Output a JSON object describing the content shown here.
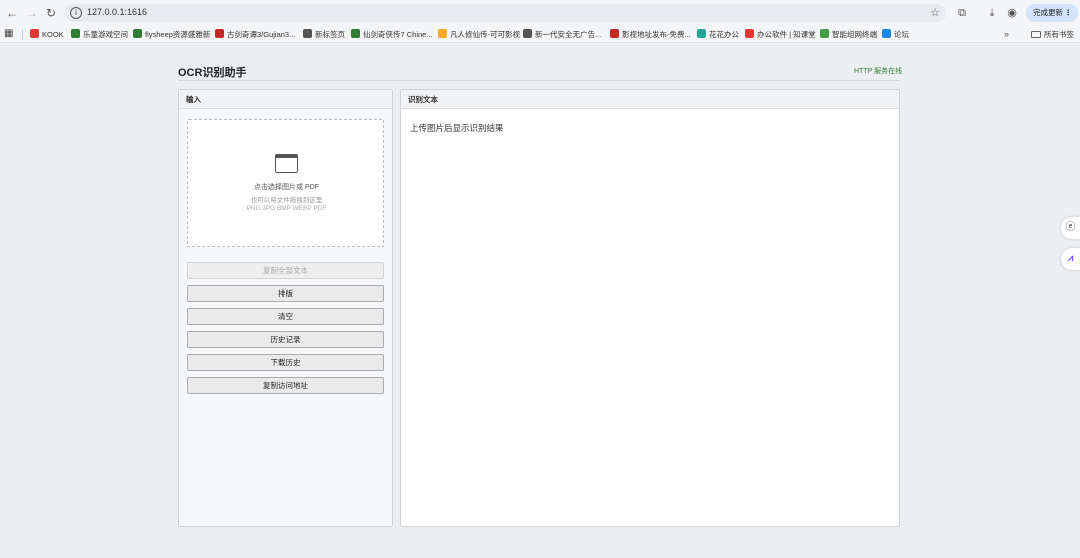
{
  "browser": {
    "url": "127.0.0.1:1616",
    "update_button": "完成更新",
    "bookmarks": [
      {
        "label": "KOOK",
        "color": "#e53935"
      },
      {
        "label": "乐童游戏空间",
        "color": "#2e7d32"
      },
      {
        "label": "flysheep资源盛雅新",
        "color": "#2e7d32"
      },
      {
        "label": "古剑奇谭3/Gujian3...",
        "color": "#c62828"
      },
      {
        "label": "新标签页",
        "color": "#555555"
      },
      {
        "label": "仙剑奇侠传7 Chine...",
        "color": "#2e7d32"
      },
      {
        "label": "凡人修仙传-可可影视",
        "color": "#f9a825"
      },
      {
        "label": "新一代安全无广告...",
        "color": "#555555"
      },
      {
        "label": "影视地址发布-免费...",
        "color": "#c62828"
      },
      {
        "label": "花花办公",
        "color": "#26a69a"
      },
      {
        "label": "办公软件 | 知课堂",
        "color": "#e53935"
      },
      {
        "label": "智能组网终端",
        "color": "#43a047"
      },
      {
        "label": "论坛",
        "color": "#1e88e5"
      }
    ],
    "all_bookmarks": "所有书签"
  },
  "app": {
    "title": "OCR识别助手",
    "status": "HTTP 服务在线",
    "input_panel": {
      "title": "输入",
      "dropzone": {
        "line1": "点击选择图片或 PDF",
        "line2": "也可以将文件拖拽到这里",
        "formats": "PNG JPG BMP WEBP PDF"
      },
      "buttons": {
        "copy_all": "复制全部文本",
        "layout": "排版",
        "clear": "清空",
        "history": "历史记录",
        "download_history": "下载历史",
        "copy_url": "复制访问地址"
      }
    },
    "result_panel": {
      "title": "识别文本",
      "placeholder": "上传图片后显示识别结果"
    }
  }
}
